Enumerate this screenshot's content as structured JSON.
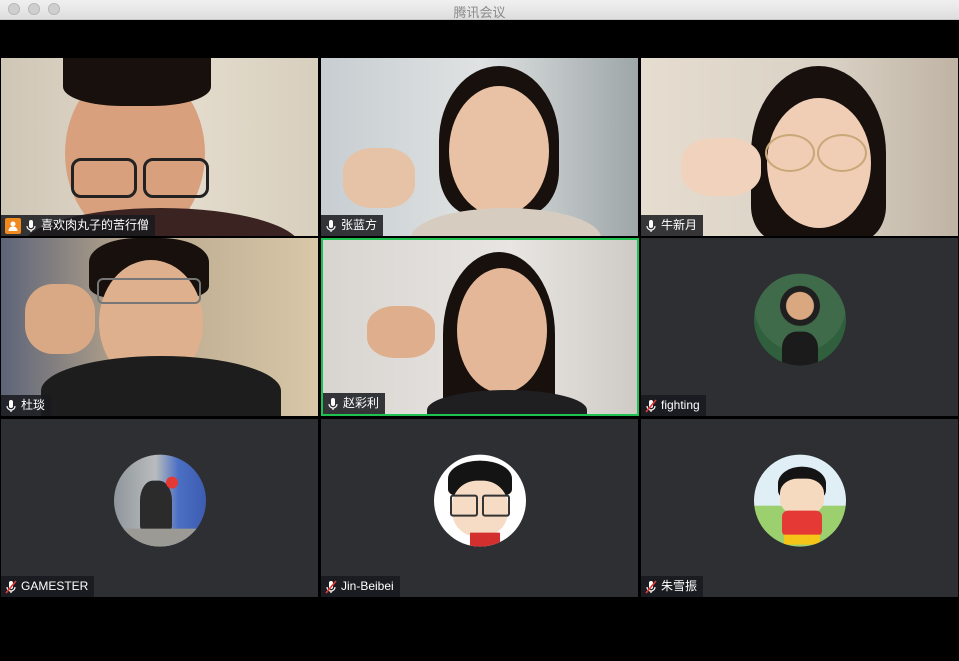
{
  "window": {
    "title": "腾讯会议"
  },
  "participants": [
    {
      "name": "喜欢肉丸子的苦行僧",
      "host": true,
      "mic": "on",
      "video": true
    },
    {
      "name": "张蓝方",
      "host": false,
      "mic": "on",
      "video": true
    },
    {
      "name": "牛新月",
      "host": false,
      "mic": "on",
      "video": true
    },
    {
      "name": "杜琰",
      "host": false,
      "mic": "on",
      "video": true
    },
    {
      "name": "赵彩利",
      "host": false,
      "mic": "on",
      "video": true,
      "speaking": true
    },
    {
      "name": "fighting",
      "host": false,
      "mic": "muted",
      "video": false
    },
    {
      "name": "GAMESTER",
      "host": false,
      "mic": "muted",
      "video": false
    },
    {
      "name": "Jin-Beibei",
      "host": false,
      "mic": "muted",
      "video": false
    },
    {
      "name": "朱雪振",
      "host": false,
      "mic": "muted",
      "video": false
    }
  ],
  "colors": {
    "active_speaker_border": "#1ec251",
    "host_badge": "#f08a1f",
    "muted_icon": "#e53935",
    "tile_background": "#2d2f33"
  },
  "icons": {
    "host": "person-icon",
    "mic_on": "microphone-icon",
    "mic_muted": "microphone-muted-icon"
  }
}
